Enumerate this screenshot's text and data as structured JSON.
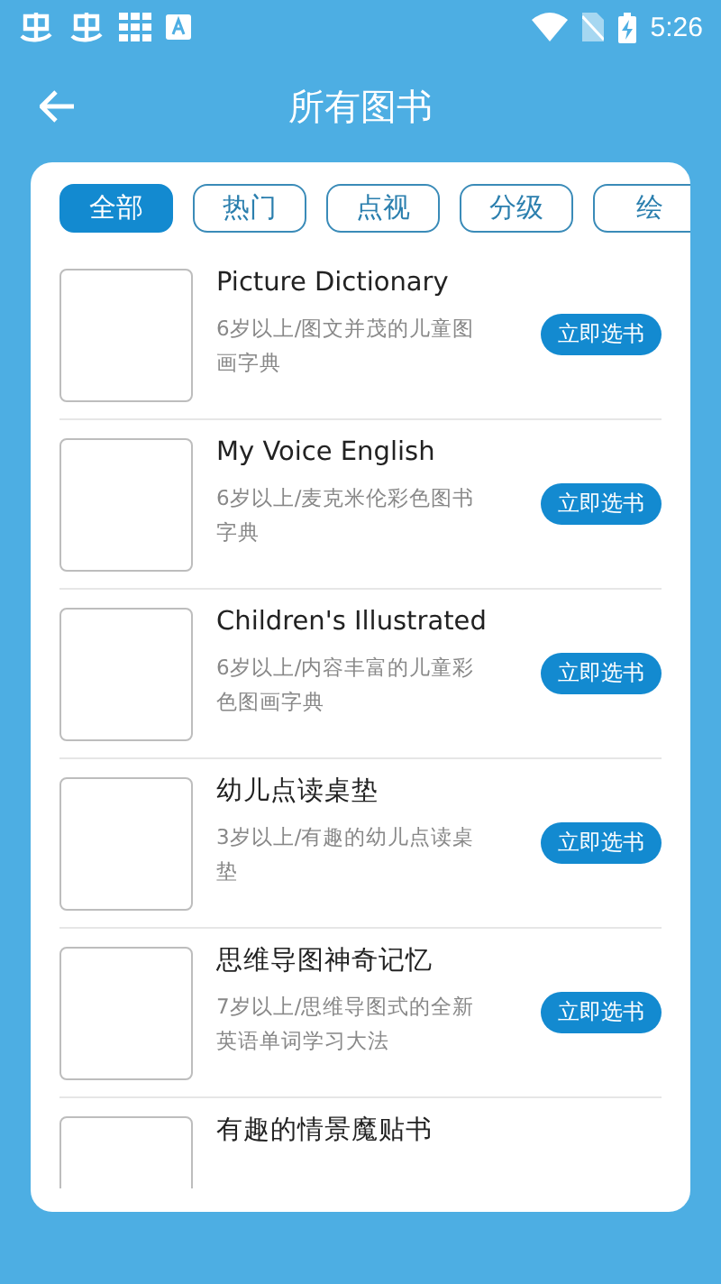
{
  "status_bar": {
    "time": "5:26"
  },
  "header": {
    "title": "所有图书"
  },
  "tabs": [
    {
      "label": "全部",
      "selected": true
    },
    {
      "label": "热门",
      "selected": false
    },
    {
      "label": "点视",
      "selected": false
    },
    {
      "label": "分级",
      "selected": false
    },
    {
      "label": "绘",
      "selected": false
    }
  ],
  "books": [
    {
      "title": "Picture Dictionary",
      "description": "6岁以上/图文并茂的儿童图画字典",
      "button": "立即选书"
    },
    {
      "title": "My Voice English",
      "description": "6岁以上/麦克米伦彩色图书字典",
      "button": "立即选书"
    },
    {
      "title": "Children's Illustrated",
      "description": "6岁以上/内容丰富的儿童彩色图画字典",
      "button": "立即选书"
    },
    {
      "title": "幼儿点读桌垫",
      "description": "3岁以上/有趣的幼儿点读桌垫",
      "button": "立即选书"
    },
    {
      "title": "思维导图神奇记忆",
      "description": "7岁以上/思维导图式的全新英语单词学习大法",
      "button": "立即选书"
    },
    {
      "title": "有趣的情景魔贴书"
    }
  ]
}
